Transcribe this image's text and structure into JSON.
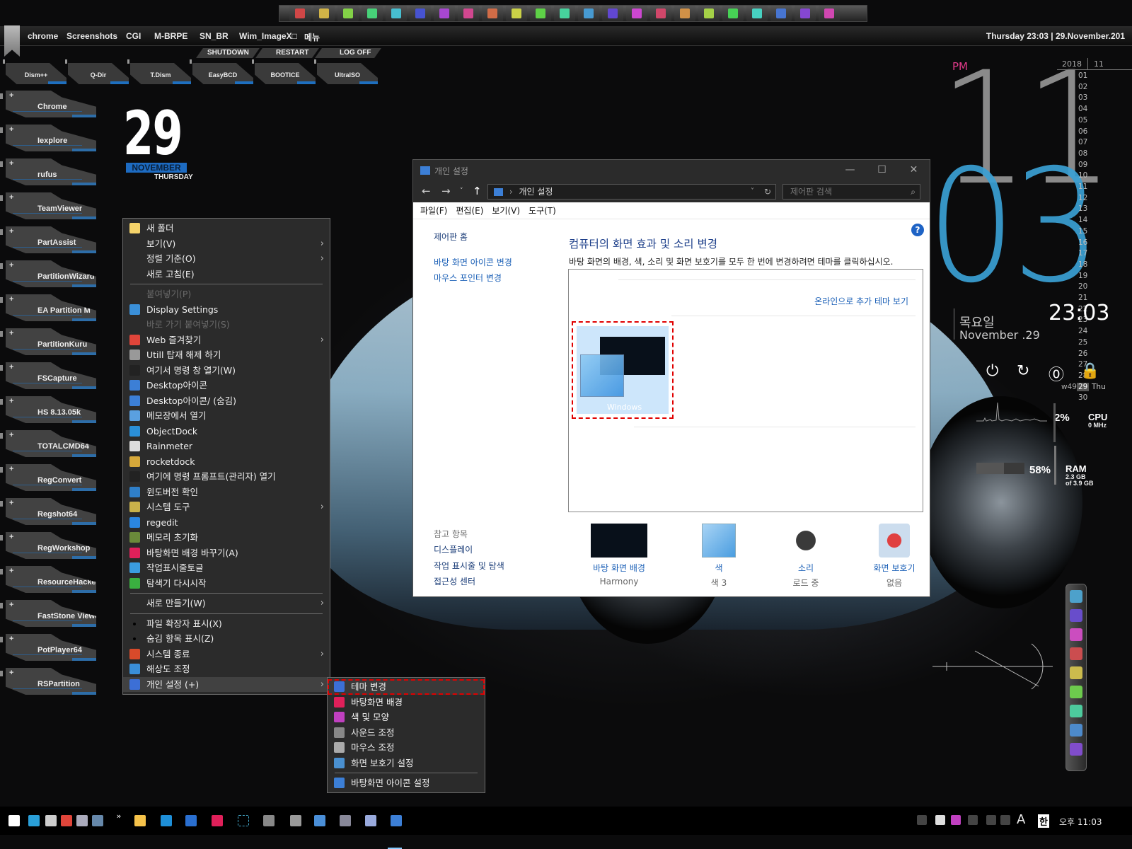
{
  "top_dock": {
    "icons": [
      "windows-flag-icon",
      "triangle-app-icon",
      "computer-icon",
      "text-a-icon",
      "windows-logo-icon",
      "bridge-icon",
      "objectdock-icon",
      "drive-icon",
      "backup-icon",
      "pencil-app-icon",
      "g-app-icon",
      "notepad-icon",
      "disc-icon",
      "pin-app-icon",
      "gears-icon",
      "text-app-icon",
      "pack-icon",
      "usb-icon",
      "paint-icon",
      "blue-ball-icon",
      "r-icon",
      "pen-nib-icon",
      "tools-icon"
    ]
  },
  "menubar": {
    "items": [
      "chrome",
      "Screenshots",
      "CGI",
      "M-BRPE",
      "SN_BR",
      "Wim_ImageX□",
      "메뉴"
    ],
    "clock": "Thursday 23:03 | 29.November.201"
  },
  "session_buttons": [
    "SHUTDOWN",
    "RESTART",
    "LOG OFF"
  ],
  "tool_tiles": [
    "Dism++",
    "Q-Dir",
    "T.Dism",
    "EasyBCD",
    "BOOTICE",
    "UltraISO"
  ],
  "side_launcher": [
    "Chrome",
    "Iexplore",
    "rufus",
    "TeamViewer",
    "PartAssist",
    "PartitionWizard",
    "EA Partition M",
    "PartitionKuru",
    "FSCapture",
    "HS 8.13.05k",
    "TOTALCMD64",
    "RegConvert",
    "Regshot64",
    "RegWorkshop",
    "ResourceHacker",
    "FastStone Viewer",
    "PotPlayer64",
    "RSPartition"
  ],
  "date_widget": {
    "day": "29",
    "month": "NOVEMBER",
    "weekday": "THURSDAY"
  },
  "context_menu": {
    "items": [
      {
        "label": "새 폴더",
        "icon": "folder-icon",
        "arrow": false,
        "disabled": false
      },
      {
        "label": "보기(V)",
        "icon": "",
        "arrow": true,
        "disabled": false
      },
      {
        "label": "정렬 기준(O)",
        "icon": "",
        "arrow": true,
        "disabled": false
      },
      {
        "label": "새로 고침(E)",
        "icon": "",
        "arrow": false,
        "disabled": false
      },
      {
        "sep": true
      },
      {
        "label": "붙여넣기(P)",
        "icon": "",
        "arrow": false,
        "disabled": true
      },
      {
        "label": "Display Settings",
        "icon": "monitor-icon",
        "arrow": false,
        "disabled": false
      },
      {
        "label": "바로 가기 붙여넣기(S)",
        "icon": "",
        "arrow": false,
        "disabled": true
      },
      {
        "label": "Web 즐겨찾기",
        "icon": "chrome-icon",
        "arrow": true,
        "disabled": false
      },
      {
        "label": "Utill 탑재 해제 하기",
        "icon": "eject-drive-icon",
        "arrow": false,
        "disabled": false
      },
      {
        "label": "여기서 명령 창 열기(W)",
        "icon": "cmd-icon",
        "arrow": false,
        "disabled": false
      },
      {
        "label": "Desktop아이콘",
        "icon": "desktop-icon",
        "arrow": false,
        "disabled": false
      },
      {
        "label": "Desktop아이콘/ (숨김)",
        "icon": "desktop-icon",
        "arrow": false,
        "disabled": false
      },
      {
        "label": "메모장에서 열기",
        "icon": "notepad-icon",
        "arrow": false,
        "disabled": false
      },
      {
        "label": "ObjectDock",
        "icon": "objectdock-icon",
        "arrow": false,
        "disabled": false
      },
      {
        "label": "Rainmeter",
        "icon": "raindrop-icon",
        "arrow": false,
        "disabled": false
      },
      {
        "label": "rocketdock",
        "icon": "rocketdock-icon",
        "arrow": false,
        "disabled": false
      },
      {
        "label": "여기에 명령 프롬프트(관리자) 열기",
        "icon": "cmd-icon",
        "arrow": false,
        "disabled": false
      },
      {
        "label": "윈도버전 확인",
        "icon": "winver-icon",
        "arrow": false,
        "disabled": false
      },
      {
        "label": "시스템 도구",
        "icon": "system-tools-icon",
        "arrow": true,
        "disabled": false
      },
      {
        "label": "regedit",
        "icon": "regedit-icon",
        "arrow": false,
        "disabled": false
      },
      {
        "label": "메모리 초기화",
        "icon": "memory-icon",
        "arrow": false,
        "disabled": false
      },
      {
        "label": "바탕화면 배경 바꾸기(A)",
        "icon": "wallpaper-icon",
        "arrow": false,
        "disabled": false
      },
      {
        "label": "작업표시줄토글",
        "icon": "taskbar-icon",
        "arrow": false,
        "disabled": false
      },
      {
        "label": "탐색기 다시시작",
        "icon": "refresh-icon",
        "arrow": false,
        "disabled": false
      },
      {
        "sep": true
      },
      {
        "label": "새로 만들기(W)",
        "icon": "",
        "arrow": true,
        "disabled": false
      },
      {
        "sep": true
      },
      {
        "label": "파일 확장자 표시(X)",
        "icon": "bullet",
        "arrow": false,
        "disabled": false
      },
      {
        "label": "숨김 항목 표시(Z)",
        "icon": "bullet",
        "arrow": false,
        "disabled": false
      },
      {
        "label": "시스템 종료",
        "icon": "power-icon",
        "arrow": true,
        "disabled": false
      },
      {
        "label": "해상도 조정",
        "icon": "monitor-icon",
        "arrow": false,
        "disabled": false
      },
      {
        "label": "개인 설정 (+)",
        "icon": "personalize-icon",
        "arrow": true,
        "disabled": false,
        "active": true
      }
    ]
  },
  "submenu": {
    "items": [
      {
        "label": "테마 변경",
        "icon": "personalize-icon",
        "highlighted": true
      },
      {
        "label": "바탕화면 배경",
        "icon": "wallpaper-icon"
      },
      {
        "label": "색 및 모양",
        "icon": "color-icon"
      },
      {
        "label": "사운드 조정",
        "icon": "speaker-icon"
      },
      {
        "label": "마우스 조정",
        "icon": "mouse-icon"
      },
      {
        "label": "화면 보호기 설정",
        "icon": "screensaver-icon"
      },
      {
        "sep": true
      },
      {
        "label": "바탕화면 아이콘 설정",
        "icon": "desktop-icon"
      }
    ]
  },
  "window": {
    "title": "개인 설정",
    "address": "개인 설정",
    "search_placeholder": "제어판 검색",
    "menu": [
      "파일(F)",
      "편집(E)",
      "보기(V)",
      "도구(T)"
    ],
    "left_links": [
      "제어판 홈",
      "바탕 화면 아이콘 변경",
      "마우스 포인터 변경"
    ],
    "see_also_label": "참고 항목",
    "see_also": [
      "디스플레이",
      "작업 표시줄 및 탐색",
      "접근성 센터"
    ],
    "heading": "컴퓨터의 화면 효과 및 소리 변경",
    "description": "바탕 화면의 배경, 색, 소리 및 화면 보호기를 모두 한 번에 변경하려면 테마를 클릭하십시오.",
    "online_themes_link": "온라인으로 추가 테마 보기",
    "theme_name": "Windows",
    "bottom": [
      {
        "label": "바탕 화면 배경",
        "value": "Harmony",
        "icon": "wallpaper-thumb-icon"
      },
      {
        "label": "색",
        "value": "색 3",
        "icon": "color-swatch-icon"
      },
      {
        "label": "소리",
        "value": "로드 중",
        "icon": "sound-icon"
      },
      {
        "label": "화면 보호기",
        "value": "없음",
        "icon": "screensaver-icon"
      }
    ],
    "help": "?"
  },
  "clock_widget": {
    "ampm": "PM",
    "hour": "11",
    "minute": "03",
    "time": "23:03",
    "weekday_ko": "목요일",
    "date_en": "November .29",
    "year": "2018",
    "month": "11",
    "days": [
      "01",
      "02",
      "03",
      "04",
      "05",
      "06",
      "07",
      "08",
      "09",
      "10",
      "11",
      "12",
      "13",
      "14",
      "15",
      "16",
      "17",
      "18",
      "19",
      "20",
      "21",
      "22",
      "23",
      "24",
      "25",
      "26",
      "27",
      "28",
      "29",
      "30"
    ],
    "today": "29",
    "week": "w49",
    "today_dow": "Thu"
  },
  "system_monitor": {
    "cpu_percent": "2%",
    "cpu_label": "CPU",
    "cpu_freq": "0 MHz",
    "ram_percent": "58%",
    "ram_label": "RAM",
    "ram_used": "2.3 GB",
    "ram_total": "of 3.9 GB",
    "ram_fraction": 0.58
  },
  "taskbar": {
    "clock": "오후 11:03",
    "ime": "한",
    "ime_mode": "A",
    "overflow": "»"
  },
  "colors": {
    "accent_blue": "#3aa0d4",
    "pm_pink": "#e23a8a",
    "link": "#1b60b7",
    "highlight_red": "#e00000"
  }
}
